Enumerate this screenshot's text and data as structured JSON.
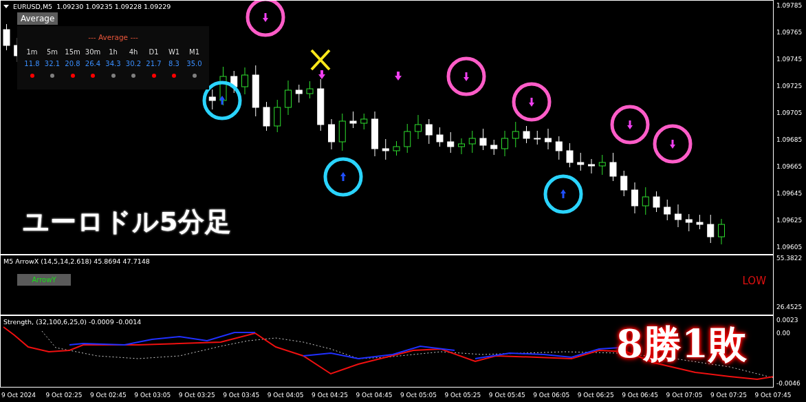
{
  "symbol_bar": {
    "title": "EURUSD,M5",
    "quote": "1.09230 1.09235 1.09228 1.09229"
  },
  "average_panel": {
    "button": "Average",
    "heading": "--- Average ---",
    "columns": [
      {
        "timeframe": "1m",
        "value": "11.8",
        "color": "#ff0000"
      },
      {
        "timeframe": "5m",
        "value": "32.1",
        "color": "#808080"
      },
      {
        "timeframe": "15m",
        "value": "20.8",
        "color": "#ff0000"
      },
      {
        "timeframe": "30m",
        "value": "26.4",
        "color": "#ff0000"
      },
      {
        "timeframe": "1h",
        "value": "34.3",
        "color": "#808080"
      },
      {
        "timeframe": "4h",
        "value": "30.2",
        "color": "#808080"
      },
      {
        "timeframe": "D1",
        "value": "21.7",
        "color": "#ff0000"
      },
      {
        "timeframe": "W1",
        "value": "8.3",
        "color": "#ff0000"
      },
      {
        "timeframe": "M1",
        "value": "35.0",
        "color": "#808080"
      }
    ]
  },
  "caption": "ユーロドル5分足",
  "price_axis": [
    "1.09785",
    "1.09765",
    "1.09745",
    "1.09725",
    "1.09705",
    "1.09685",
    "1.09665",
    "1.09645",
    "1.09625",
    "1.09605"
  ],
  "arrow_panel": {
    "title": "M5  ArrowX (14,5,14,2.618) 45.8694 47.7148",
    "button": "ArrowY",
    "signal": "LOW",
    "axis": [
      "55.3822",
      "26.4525"
    ]
  },
  "strength_panel": {
    "title": "Strength, (32,100,6,25,0) -0.0009 -0.0014",
    "result": "8勝1敗",
    "axis": [
      "0.0023",
      "0.00",
      "-0.0046"
    ]
  },
  "time_axis": [
    "9 Oct 2024",
    "9 Oct 02:25",
    "9 Oct 02:45",
    "9 Oct 03:05",
    "9 Oct 03:25",
    "9 Oct 03:45",
    "9 Oct 04:05",
    "9 Oct 04:25",
    "9 Oct 04:45",
    "9 Oct 05:05",
    "9 Oct 05:25",
    "9 Oct 05:45",
    "9 Oct 06:05",
    "9 Oct 06:25",
    "9 Oct 06:45",
    "9 Oct 07:05",
    "9 Oct 07:25",
    "9 Oct 07:45"
  ]
}
